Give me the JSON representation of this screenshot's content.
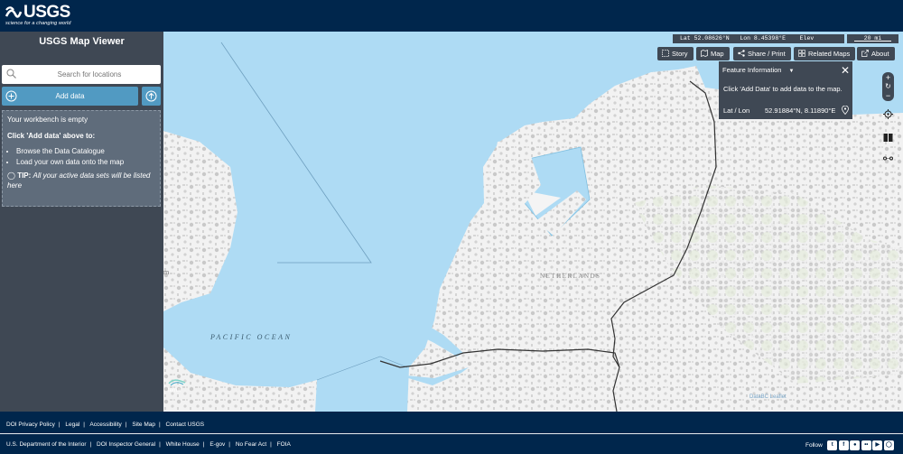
{
  "header": {
    "logo_text": "USGS",
    "logo_tagline": "science for a changing world"
  },
  "sidebar": {
    "title": "USGS Map Viewer",
    "search_placeholder": "Search for locations",
    "add_data_label": "Add data",
    "workbench": {
      "empty_text": "Your workbench is empty",
      "instruction": "Click 'Add data' above to:",
      "bullets": [
        "Browse the Data Catalogue",
        "Load your own data onto the map"
      ],
      "tip_label": "TIP:",
      "tip_text": "All your active data sets will be listed here"
    }
  },
  "map": {
    "coords": {
      "lat": "Lat  52.08626°N",
      "lon": "Lon  8.45398°E",
      "elev": "Elev"
    },
    "scale_label": "20 mi",
    "buttons": {
      "story": "Story",
      "map": "Map",
      "share": "Share / Print",
      "related": "Related Maps",
      "about": "About"
    },
    "feature_info": {
      "title": "Feature Information",
      "message": "Click 'Add Data' to add data to the map.",
      "latlon_label": "Lat / Lon",
      "latlon_value": "52.91884°N, 8.11890°E"
    },
    "labels": {
      "ocean": "PACIFIC OCEAN",
      "country": "NETHERLANDS",
      "partial_left": "m"
    },
    "terria_logo": "terria",
    "attribution": "DataBC   Leaflet"
  },
  "footer": {
    "row1": [
      "DOI Privacy Policy",
      "Legal",
      "Accessibility",
      "Site Map",
      "Contact USGS"
    ],
    "row2": [
      "U.S. Department of the Interior",
      "DOI Inspector General",
      "White House",
      "E-gov",
      "No Fear Act",
      "FOIA"
    ],
    "follow_label": "Follow",
    "social_icons": [
      "twitter-icon",
      "facebook-icon",
      "github-icon",
      "flickr-icon",
      "youtube-icon",
      "instagram-icon"
    ]
  },
  "colors": {
    "header_bg": "#00264c",
    "panel_bg": "#3f4854",
    "accent": "#519ac2",
    "water": "#aedbf4",
    "land": "#f3f3f3"
  }
}
